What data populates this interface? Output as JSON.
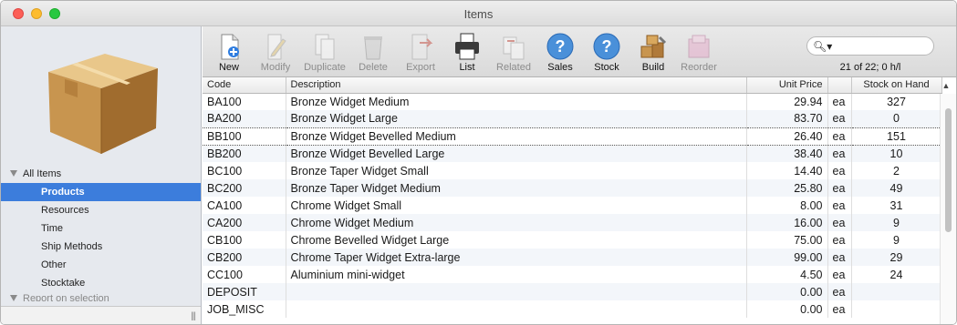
{
  "window": {
    "title": "Items"
  },
  "sidebar": {
    "groups": [
      {
        "label": "All Items",
        "items": [
          "Products",
          "Resources",
          "Time",
          "Ship Methods",
          "Other",
          "Stocktake"
        ]
      }
    ],
    "selected": "Products",
    "cut_off_item": "Report on selection"
  },
  "toolbar": {
    "buttons": [
      {
        "label": "New",
        "icon": "new-document-icon",
        "enabled": true
      },
      {
        "label": "Modify",
        "icon": "pencil-icon",
        "enabled": false
      },
      {
        "label": "Duplicate",
        "icon": "duplicate-icon",
        "enabled": false
      },
      {
        "label": "Delete",
        "icon": "trash-icon",
        "enabled": false
      },
      {
        "label": "Export",
        "icon": "export-icon",
        "enabled": false
      },
      {
        "label": "List",
        "icon": "printer-icon",
        "enabled": true
      },
      {
        "label": "Related",
        "icon": "related-icon",
        "enabled": false
      },
      {
        "label": "Sales",
        "icon": "help-icon",
        "enabled": true
      },
      {
        "label": "Stock",
        "icon": "help-icon",
        "enabled": true
      },
      {
        "label": "Build",
        "icon": "build-boxes-icon",
        "enabled": true
      },
      {
        "label": "Reorder",
        "icon": "reorder-icon",
        "enabled": false
      }
    ],
    "search": {
      "value": "",
      "placeholder": ""
    },
    "record_count": "21 of 22; 0 h/l"
  },
  "table": {
    "columns": [
      "Code",
      "Description",
      "Unit Price",
      "",
      "Stock on Hand"
    ],
    "rows": [
      [
        "BA100",
        "Bronze Widget Medium",
        "29.94",
        "ea",
        "327"
      ],
      [
        "BA200",
        "Bronze Widget Large",
        "83.70",
        "ea",
        "0"
      ],
      [
        "BB100",
        "Bronze Widget Bevelled Medium",
        "26.40",
        "ea",
        "151"
      ],
      [
        "BB200",
        "Bronze Widget Bevelled Large",
        "38.40",
        "ea",
        "10"
      ],
      [
        "BC100",
        "Bronze Taper Widget Small",
        "14.40",
        "ea",
        "2"
      ],
      [
        "BC200",
        "Bronze Taper Widget Medium",
        "25.80",
        "ea",
        "49"
      ],
      [
        "CA100",
        "Chrome Widget Small",
        "8.00",
        "ea",
        "31"
      ],
      [
        "CA200",
        "Chrome Widget Medium",
        "16.00",
        "ea",
        "9"
      ],
      [
        "CB100",
        "Chrome Bevelled Widget Large",
        "75.00",
        "ea",
        "9"
      ],
      [
        "CB200",
        "Chrome Taper Widget Extra-large",
        "99.00",
        "ea",
        "29"
      ],
      [
        "CC100",
        "Aluminium mini-widget",
        "4.50",
        "ea",
        "24"
      ],
      [
        "DEPOSIT",
        "",
        "0.00",
        "ea",
        ""
      ],
      [
        "JOB_MISC",
        "",
        "0.00",
        "ea",
        ""
      ]
    ],
    "focused_row_index": 2
  },
  "colors": {
    "selection": "#3c7ddc",
    "sidebar_bg": "#e6e9ee"
  }
}
